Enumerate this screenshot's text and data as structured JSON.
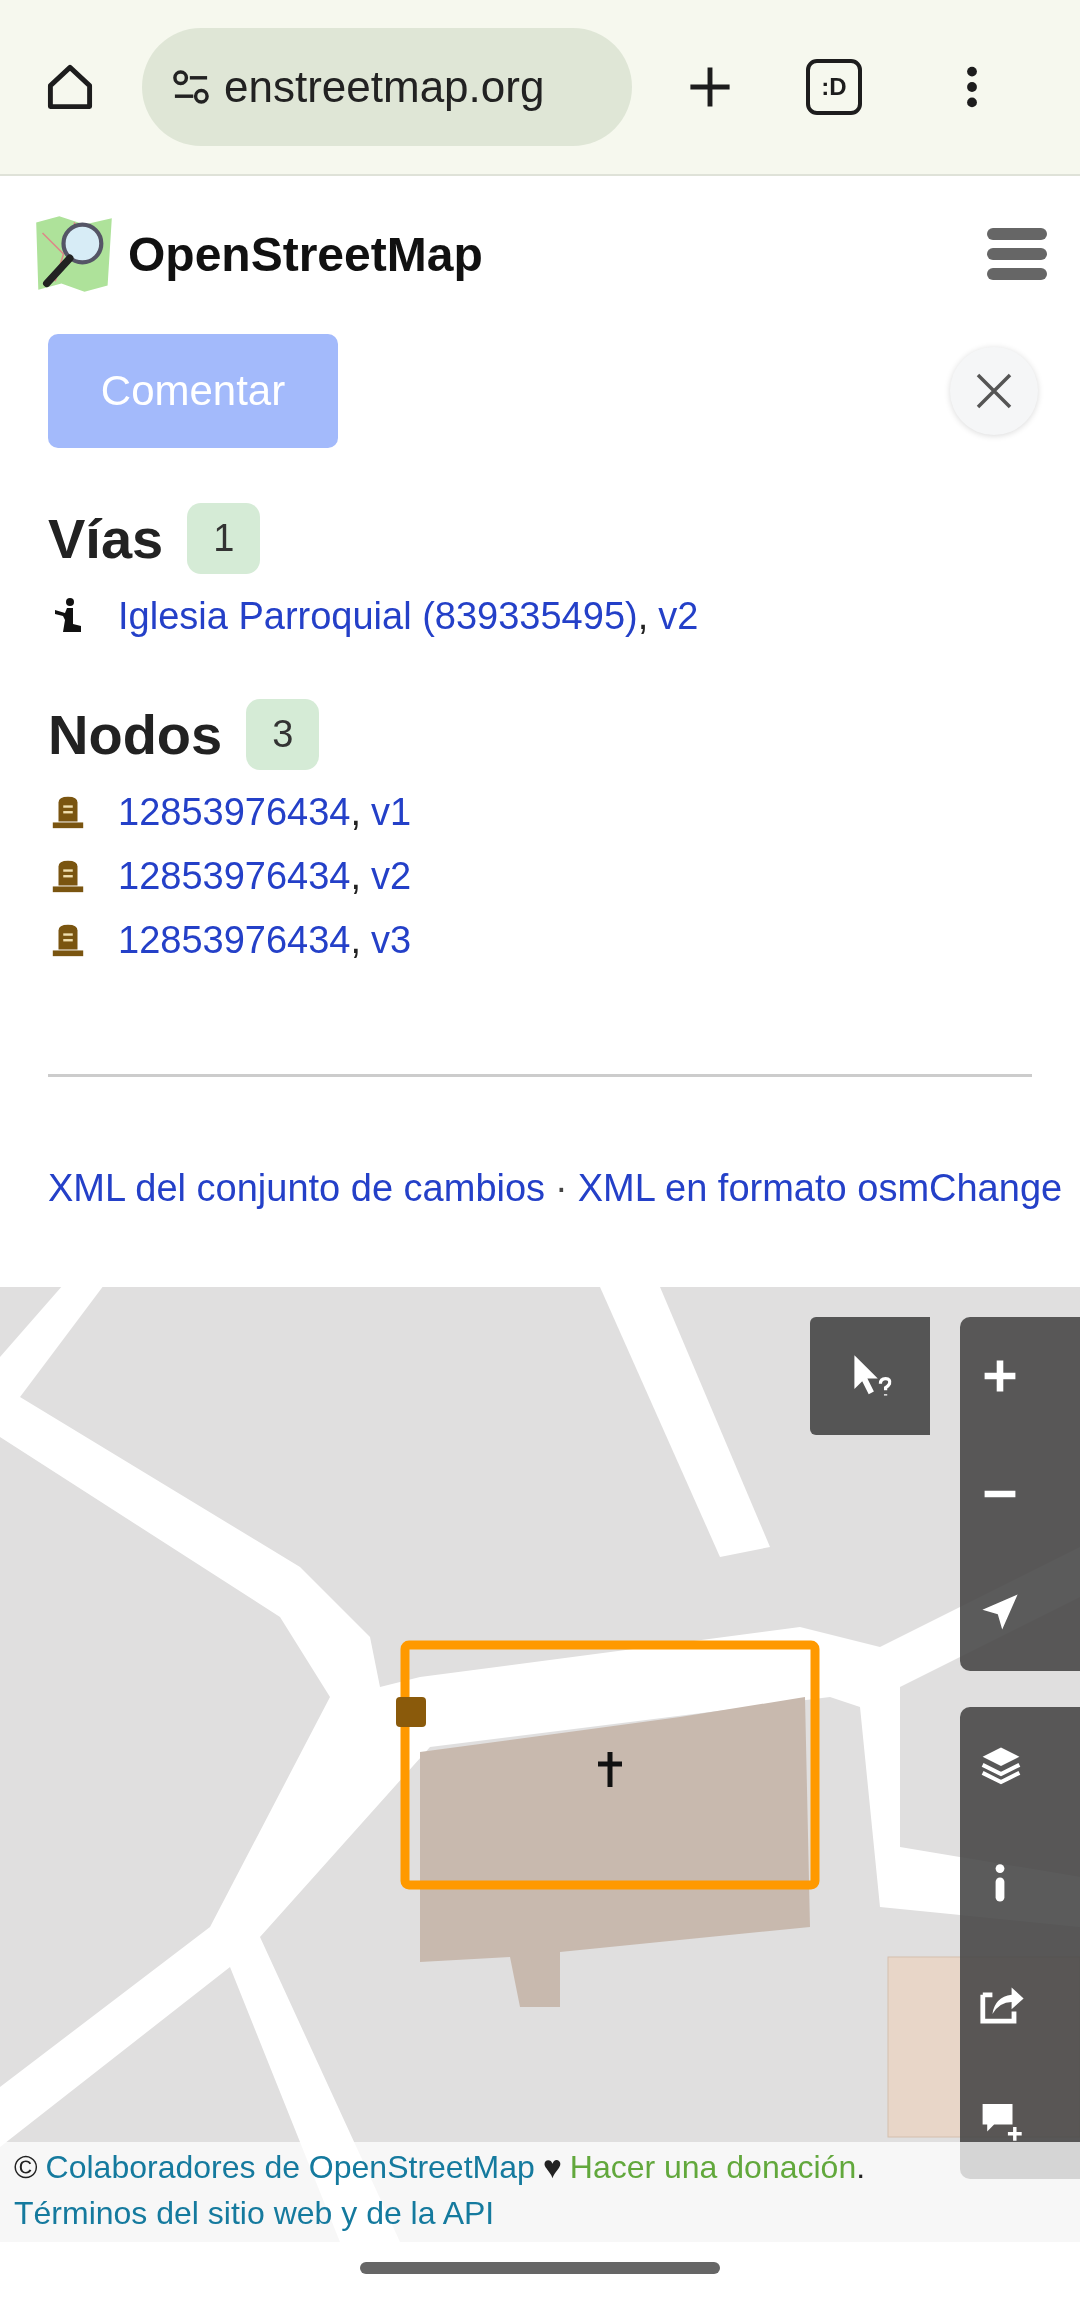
{
  "browser": {
    "url": "enstreetmap.org",
    "tabs_label": ":D"
  },
  "header": {
    "title": "OpenStreetMap"
  },
  "comment_button": {
    "label": "Comentar",
    "disabled": true
  },
  "sections": [
    {
      "title": "Vías",
      "count": "1",
      "items": [
        {
          "kind": "way",
          "link": "Iglesia Parroquial (839335495)",
          "separator": ",",
          "version": "v2"
        }
      ]
    },
    {
      "title": "Nodos",
      "count": "3",
      "items": [
        {
          "kind": "node",
          "link": "12853976434",
          "separator": ",",
          "version": "v1"
        },
        {
          "kind": "node",
          "link": "12853976434",
          "separator": ",",
          "version": "v2"
        },
        {
          "kind": "node",
          "link": "12853976434",
          "separator": ",",
          "version": "v3"
        }
      ]
    }
  ],
  "downloads": {
    "links": [
      "XML del conjunto de cambios",
      "XML en formato osmChange"
    ],
    "separator": "·"
  },
  "map": {
    "kind": "picture",
    "attribution": {
      "copyright": "©",
      "contributors": "Colaboradores de OpenStreetMap",
      "heart": "♥",
      "donate": "Hacer una donación",
      "period": ".",
      "terms": "Términos del sitio web y de la API"
    }
  }
}
